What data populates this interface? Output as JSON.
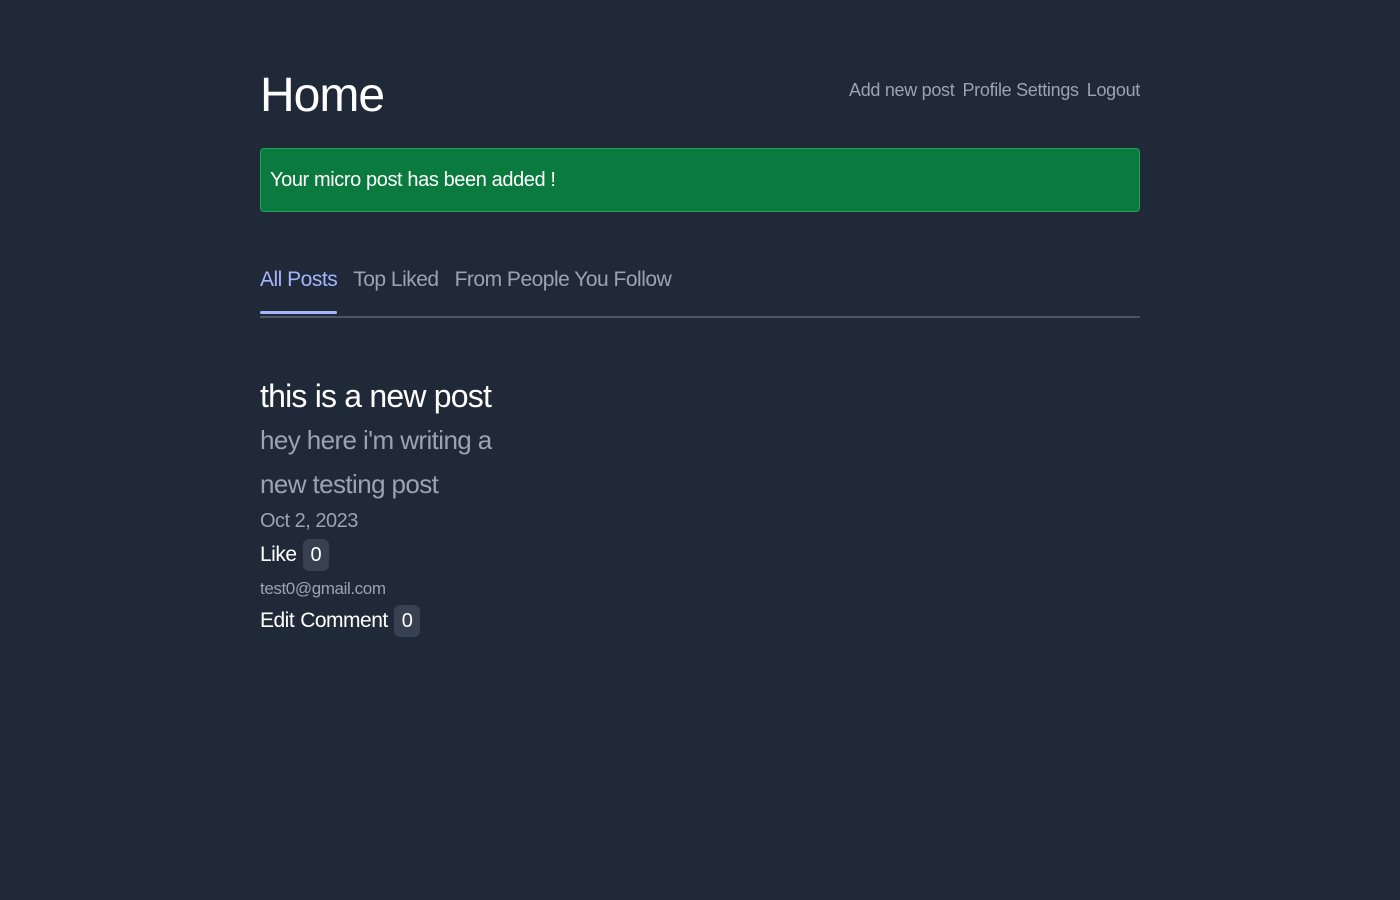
{
  "header": {
    "title": "Home",
    "nav": {
      "add_post": "Add new post",
      "profile_settings": "Profile Settings",
      "logout": "Logout"
    }
  },
  "alert": {
    "message": "Your micro post has been added !",
    "color": "#0b7a3e"
  },
  "tabs": {
    "all_posts": "All Posts",
    "top_liked": "Top Liked",
    "following": "From People You Follow",
    "active": "All Posts",
    "active_color": "#a5b4fc"
  },
  "post": {
    "title": "this is a new post",
    "body": "hey here i'm writing a new testing post",
    "date": "Oct 2, 2023",
    "like_label": "Like",
    "like_count": "0",
    "author": "test0@gmail.com",
    "edit_label": "Edit",
    "comment_label": "Comment",
    "comment_count": "0"
  }
}
